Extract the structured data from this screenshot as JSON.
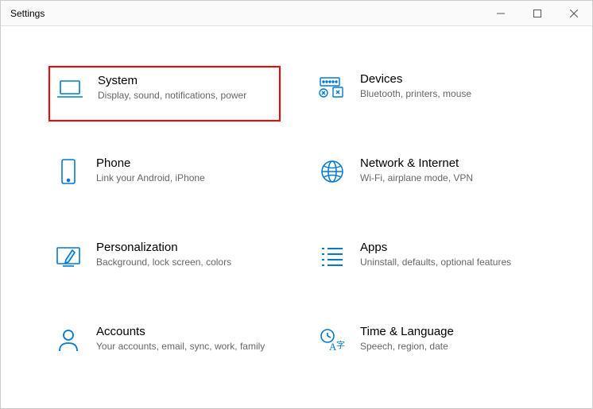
{
  "window": {
    "title": "Settings"
  },
  "tiles": [
    {
      "title": "System",
      "desc": "Display, sound, notifications, power"
    },
    {
      "title": "Devices",
      "desc": "Bluetooth, printers, mouse"
    },
    {
      "title": "Phone",
      "desc": "Link your Android, iPhone"
    },
    {
      "title": "Network & Internet",
      "desc": "Wi-Fi, airplane mode, VPN"
    },
    {
      "title": "Personalization",
      "desc": "Background, lock screen, colors"
    },
    {
      "title": "Apps",
      "desc": "Uninstall, defaults, optional features"
    },
    {
      "title": "Accounts",
      "desc": "Your accounts, email, sync, work, family"
    },
    {
      "title": "Time & Language",
      "desc": "Speech, region, date"
    }
  ]
}
